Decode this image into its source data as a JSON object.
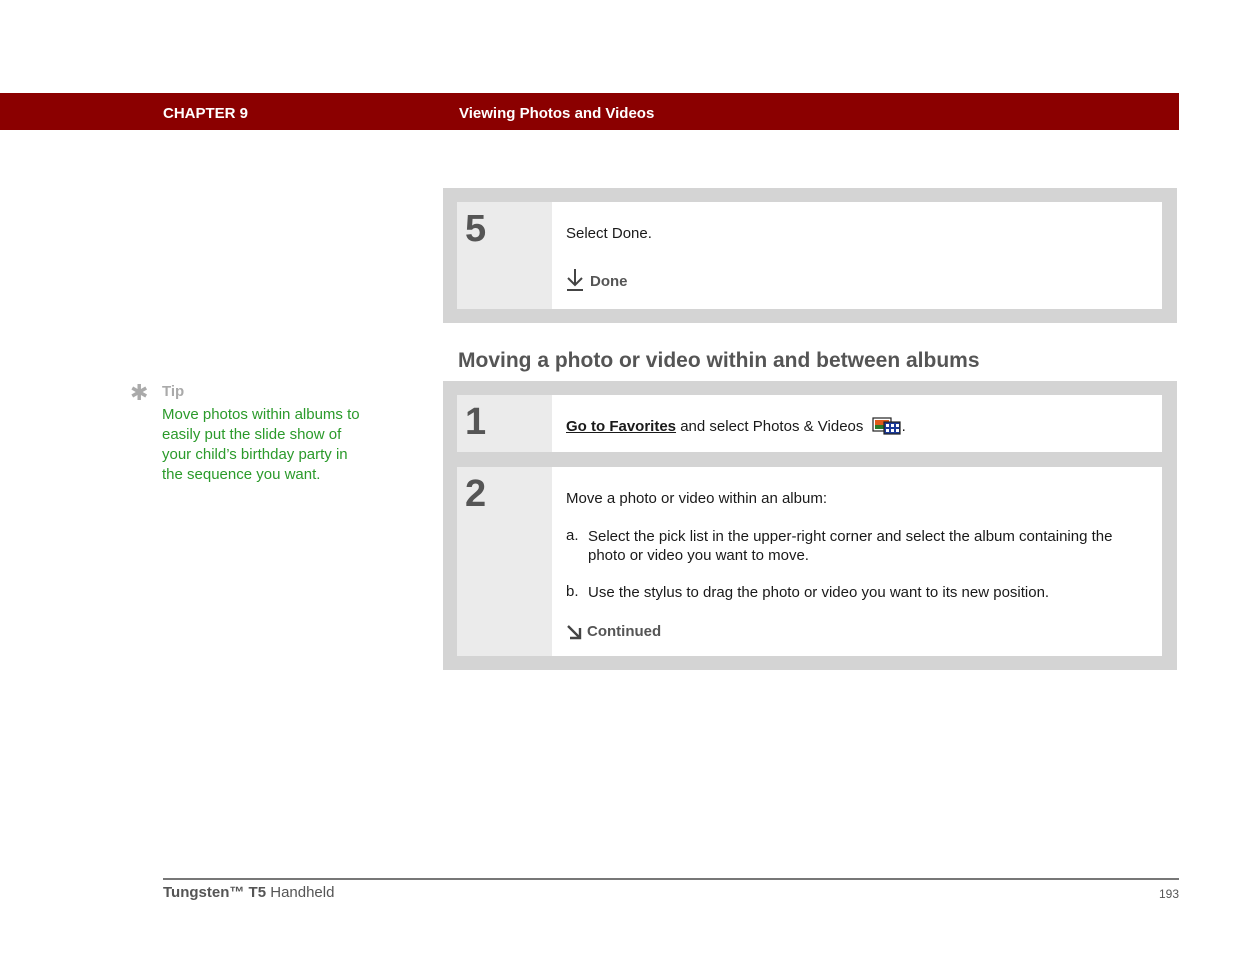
{
  "header": {
    "chapter": "CHAPTER 9",
    "title": "Viewing Photos and Videos"
  },
  "top_step": {
    "number": "5",
    "text": "Select Done.",
    "done_label": "Done"
  },
  "section_heading": "Moving a photo or video within and between albums",
  "steps": [
    {
      "number": "1",
      "link_text": "Go to Favorites",
      "text_after": " and select Photos & Videos",
      "trailing": ".",
      "icon": "photos-videos-icon"
    },
    {
      "number": "2",
      "intro": "Move a photo or video within an album:",
      "items": [
        {
          "marker": "a.",
          "text": "Select the pick list in the upper-right corner and select the album containing the photo or video you want to move."
        },
        {
          "marker": "b.",
          "text": "Use the stylus to drag the photo or video you want to its new position."
        }
      ],
      "continued_label": "Continued"
    }
  ],
  "tip": {
    "label": "Tip",
    "text": "Move photos within albums to easily put the slide show of your child’s birthday party in the sequence you want."
  },
  "footer": {
    "product_bold": "Tungsten™ T5",
    "product_rest": " Handheld",
    "page_number": "193"
  },
  "colors": {
    "header_bg": "#8b0000",
    "tip_text": "#2a9a2a",
    "box_bg": "#d4d4d4"
  }
}
